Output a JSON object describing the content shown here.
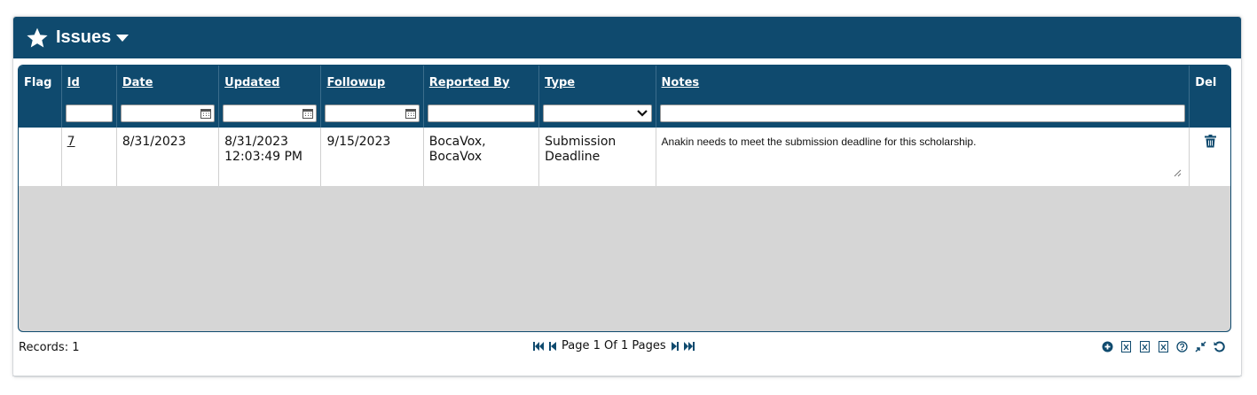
{
  "header": {
    "title": "Issues",
    "icon": "star-icon",
    "dropdown": "chevron-down-icon"
  },
  "columns": [
    {
      "key": "flag",
      "label": "Flag",
      "sortable": false
    },
    {
      "key": "id",
      "label": "Id",
      "sortable": true
    },
    {
      "key": "date",
      "label": "Date",
      "sortable": true
    },
    {
      "key": "updated",
      "label": "Updated",
      "sortable": true
    },
    {
      "key": "followup",
      "label": "Followup",
      "sortable": true
    },
    {
      "key": "reported_by",
      "label": "Reported By",
      "sortable": true
    },
    {
      "key": "type",
      "label": "Type",
      "sortable": true
    },
    {
      "key": "notes",
      "label": "Notes",
      "sortable": true
    },
    {
      "key": "del",
      "label": "Del",
      "sortable": false
    }
  ],
  "filters": {
    "id": "",
    "date": "",
    "updated": "",
    "followup": "",
    "reported_by": "",
    "type": "",
    "notes": ""
  },
  "rows": [
    {
      "flag": "",
      "id": "7",
      "date": "8/31/2023",
      "updated_date": "8/31/2023",
      "updated_time": "12:03:49 PM",
      "followup": "9/15/2023",
      "reported_by_1": "BocaVox,",
      "reported_by_2": "BocaVox",
      "type_1": "Submission",
      "type_2": "Deadline",
      "notes": "Anakin needs to meet the submission deadline for this scholarship."
    }
  ],
  "footer": {
    "records": "Records: 1",
    "page_label": "Page 1 Of 1 Pages"
  },
  "colors": {
    "header_bg": "#0f4a6e",
    "empty_area": "#d6d6d6"
  }
}
